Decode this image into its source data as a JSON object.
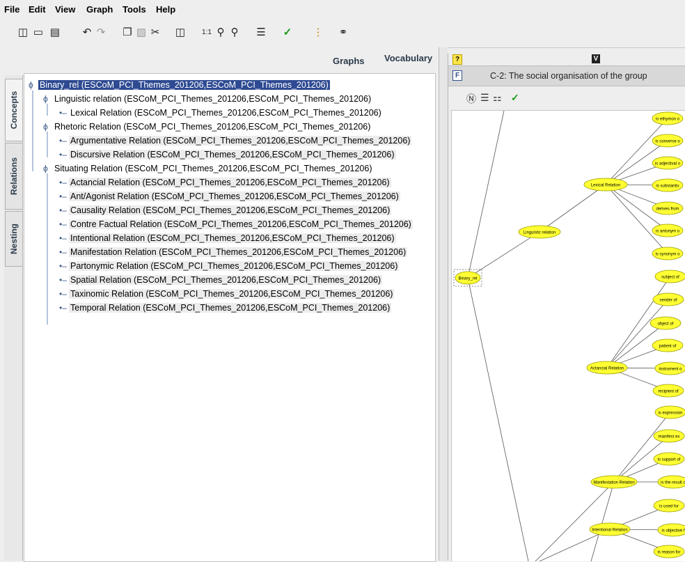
{
  "menu": [
    "File",
    "Edit",
    "View",
    "Graph",
    "Tools",
    "Help"
  ],
  "toolbar_icons": [
    "new-file-icon",
    "open-folder-icon",
    "save-icon",
    "undo-icon",
    "redo-icon",
    "copy-icon",
    "paste-icon",
    "cut-icon",
    "layout-icon",
    "zoom-actual-icon",
    "zoom-in-icon",
    "zoom-out-icon",
    "tree-layout-icon",
    "check-icon",
    "traffic-light-icon",
    "speech-bubble-icon"
  ],
  "tabs": {
    "graphs": "Graphs",
    "vocabulary": "Vocabulary"
  },
  "side_tabs": [
    "Concepts",
    "Relations",
    "Nesting"
  ],
  "tree": [
    {
      "label": "Binary_rel (ESCoM_PCI_Themes_201206,ESCoM_PCI_Themes_201206)",
      "level": 0,
      "selected": true
    },
    {
      "label": "Linguistic relation (ESCoM_PCI_Themes_201206,ESCoM_PCI_Themes_201206)",
      "level": 1
    },
    {
      "label": "Lexical Relation (ESCoM_PCI_Themes_201206,ESCoM_PCI_Themes_201206)",
      "level": 2
    },
    {
      "label": "Rhetoric Relation (ESCoM_PCI_Themes_201206,ESCoM_PCI_Themes_201206)",
      "level": 1
    },
    {
      "label": "Argumentative Relation (ESCoM_PCI_Themes_201206,ESCoM_PCI_Themes_201206)",
      "level": 2
    },
    {
      "label": "Discursive Relation (ESCoM_PCI_Themes_201206,ESCoM_PCI_Themes_201206)",
      "level": 2
    },
    {
      "label": "Situating Relation (ESCoM_PCI_Themes_201206,ESCoM_PCI_Themes_201206)",
      "level": 1
    },
    {
      "label": "Actancial Relation (ESCoM_PCI_Themes_201206,ESCoM_PCI_Themes_201206)",
      "level": 2
    },
    {
      "label": "Ant/Agonist Relation (ESCoM_PCI_Themes_201206,ESCoM_PCI_Themes_201206)",
      "level": 2
    },
    {
      "label": "Causality Relation (ESCoM_PCI_Themes_201206,ESCoM_PCI_Themes_201206)",
      "level": 2
    },
    {
      "label": "Contre Factual Relation (ESCoM_PCI_Themes_201206,ESCoM_PCI_Themes_201206)",
      "level": 2
    },
    {
      "label": "Intentional Relation (ESCoM_PCI_Themes_201206,ESCoM_PCI_Themes_201206)",
      "level": 2
    },
    {
      "label": "Manifestation Relation (ESCoM_PCI_Themes_201206,ESCoM_PCI_Themes_201206)",
      "level": 2
    },
    {
      "label": "Partonymic Relation (ESCoM_PCI_Themes_201206,ESCoM_PCI_Themes_201206)",
      "level": 2
    },
    {
      "label": "Spatial Relation (ESCoM_PCI_Themes_201206,ESCoM_PCI_Themes_201206)",
      "level": 2
    },
    {
      "label": "Taxinomic Relation (ESCoM_PCI_Themes_201206,ESCoM_PCI_Themes_201206)",
      "level": 2
    },
    {
      "label": "Temporal Relation (ESCoM_PCI_Themes_201206,ESCoM_PCI_Themes_201206)",
      "level": 2
    }
  ],
  "right": {
    "q_marker": "?",
    "v_marker": "V",
    "f_marker": "F",
    "context_title": "C-2: The social organisation of the group",
    "tools": [
      "rt-icon",
      "tree-collapse-icon",
      "hierarchy-icon",
      "check-icon"
    ],
    "graph_nodes": [
      {
        "label": "is ethymon o"
      },
      {
        "label": "is converse o"
      },
      {
        "label": "is adjectival o"
      },
      {
        "label": "is substantiv"
      },
      {
        "label": "derives from"
      },
      {
        "label": "is antonym o"
      },
      {
        "label": "is synonym o"
      },
      {
        "label": "Lexical Relation"
      },
      {
        "label": "Linguistic relation"
      },
      {
        "label": "Binary_rel"
      },
      {
        "label": "subject of"
      },
      {
        "label": "sender of"
      },
      {
        "label": "object of"
      },
      {
        "label": "patient of"
      },
      {
        "label": "Actancial Relation"
      },
      {
        "label": "instrument o"
      },
      {
        "label": "recipient of"
      },
      {
        "label": "is expression"
      },
      {
        "label": "manifest ex"
      },
      {
        "label": "is support of"
      },
      {
        "label": "Manifestation Relation"
      },
      {
        "label": "is the result o"
      },
      {
        "label": "is used for"
      },
      {
        "label": "Intentional Relation"
      },
      {
        "label": "is objective f"
      },
      {
        "label": "is reason for"
      }
    ]
  },
  "colors": {
    "selection": "#2e4a92",
    "node_fill": "#ffff33",
    "node_stroke": "#9a9a00",
    "tree_icon": "#3a5a86"
  }
}
